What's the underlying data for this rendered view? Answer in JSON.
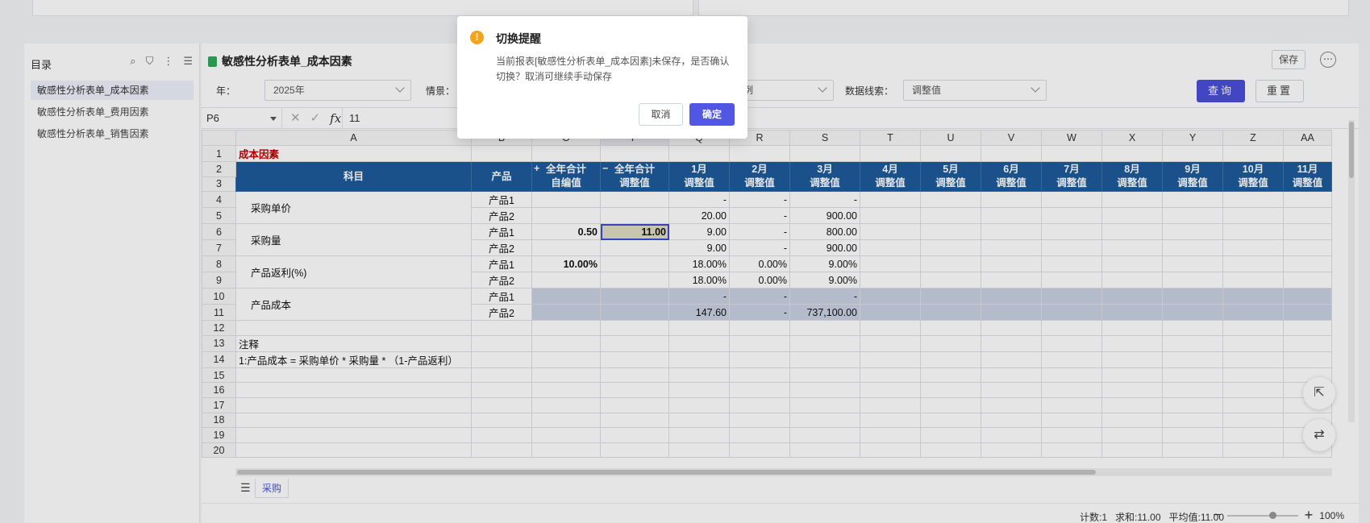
{
  "sidebar": {
    "title": "目录",
    "items": [
      {
        "label": "敏感性分析表单_成本因素"
      },
      {
        "label": "敏感性分析表单_费用因素"
      },
      {
        "label": "敏感性分析表单_销售因素"
      }
    ]
  },
  "header": {
    "title": "敏感性分析表单_成本因素",
    "save_label": "保存",
    "more_label": "⋯"
  },
  "filters": {
    "year_label": "年：",
    "year_value": "2025年",
    "scenario_label": "情景：",
    "scenario_value_partial": "例",
    "dataline_label": "数据线索：",
    "dataline_value": "调整值",
    "query_label": "查询",
    "reset_label": "重置"
  },
  "formula_bar": {
    "cell_ref": "P6",
    "fx_label": "fx",
    "value": "11"
  },
  "grid": {
    "columns": [
      "A",
      "B",
      "O",
      "P",
      "Q",
      "R",
      "S",
      "T",
      "U",
      "V",
      "W",
      "X",
      "Y",
      "Z",
      "AA"
    ],
    "row_numbers": [
      "1",
      "2",
      "3",
      "4",
      "5",
      "6",
      "7",
      "8",
      "9",
      "10",
      "11",
      "12",
      "13",
      "14",
      "15",
      "16",
      "17",
      "18",
      "19",
      "20"
    ],
    "section_title": "成本因素",
    "header": {
      "subject": "科目",
      "product": "产品",
      "total_self": "全年合计\n自编值",
      "total_adj": "全年合计\n调整值",
      "months": [
        "1月\n调整值",
        "2月\n调整值",
        "3月\n调整值",
        "4月\n调整值",
        "5月\n调整值",
        "6月\n调整值",
        "7月\n调整值",
        "8月\n调整值",
        "9月\n调整值",
        "10月\n调整值",
        "11月\n调整值"
      ]
    },
    "rows": [
      {
        "subject": "采购单价",
        "product": "产品1",
        "O": "",
        "P": "",
        "Q": "-",
        "R": "-",
        "S": "-"
      },
      {
        "subject": "",
        "product": "产品2",
        "O": "",
        "P": "",
        "Q": "20.00",
        "R": "-",
        "S": "900.00"
      },
      {
        "subject": "采购量",
        "product": "产品1",
        "O": "0.50",
        "P": "11.00",
        "Q": "9.00",
        "R": "-",
        "S": "800.00"
      },
      {
        "subject": "",
        "product": "产品2",
        "O": "",
        "P": "",
        "Q": "9.00",
        "R": "-",
        "S": "900.00"
      },
      {
        "subject": "产品返利(%)",
        "product": "产品1",
        "O": "10.00%",
        "P": "",
        "Q": "18.00%",
        "R": "0.00%",
        "S": "9.00%"
      },
      {
        "subject": "",
        "product": "产品2",
        "O": "",
        "P": "",
        "Q": "18.00%",
        "R": "0.00%",
        "S": "9.00%"
      },
      {
        "subject": "产品成本",
        "product": "产品1",
        "O": "",
        "P": "",
        "Q": "-",
        "R": "-",
        "S": "-"
      },
      {
        "subject": "",
        "product": "产品2",
        "O": "",
        "P": "",
        "Q": "147.60",
        "R": "-",
        "S": "737,100.00"
      }
    ],
    "note_title": "注释",
    "note_line": "1:产品成本 = 采购单价 * 采购量 * （1-产品返利）",
    "expand_minus": "−",
    "expand_plus": "+"
  },
  "sheet_tab": {
    "label": "采购"
  },
  "status": {
    "count": "计数:1",
    "sum": "求和:11.00",
    "avg": "平均值:11.00",
    "zoom_label": "100%",
    "zoom_level": 1.0
  },
  "modal": {
    "title": "切换提醒",
    "message": "当前报表[敏感性分析表单_成本因素]未保存，是否确认切换？取消可继续手动保存",
    "cancel_label": "取消",
    "ok_label": "确定"
  },
  "colors": {
    "accent": "#4b4fd8",
    "header_blue": "#1d5b9a",
    "warning": "#f4a31d",
    "section_red": "#c00000"
  }
}
